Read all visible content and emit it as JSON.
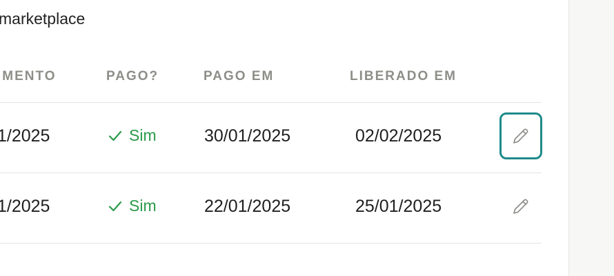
{
  "section": {
    "subtitle": "marketplace"
  },
  "table": {
    "headers": {
      "due": "IMENTO",
      "paid": "PAGO?",
      "paid_on": "PAGO EM",
      "released_on": "LIBERADO EM"
    },
    "rows": [
      {
        "due": "1/2025",
        "paid": "Sim",
        "paid_on": "30/01/2025",
        "released_on": "02/02/2025",
        "edit_icon": "pencil-icon",
        "focused": true
      },
      {
        "due": "1/2025",
        "paid": "Sim",
        "paid_on": "22/01/2025",
        "released_on": "25/01/2025",
        "edit_icon": "pencil-icon",
        "focused": false
      }
    ]
  },
  "colors": {
    "success": "#2a9a48",
    "focus_ring": "#1f8a8a",
    "header_text": "#8e8e88"
  }
}
